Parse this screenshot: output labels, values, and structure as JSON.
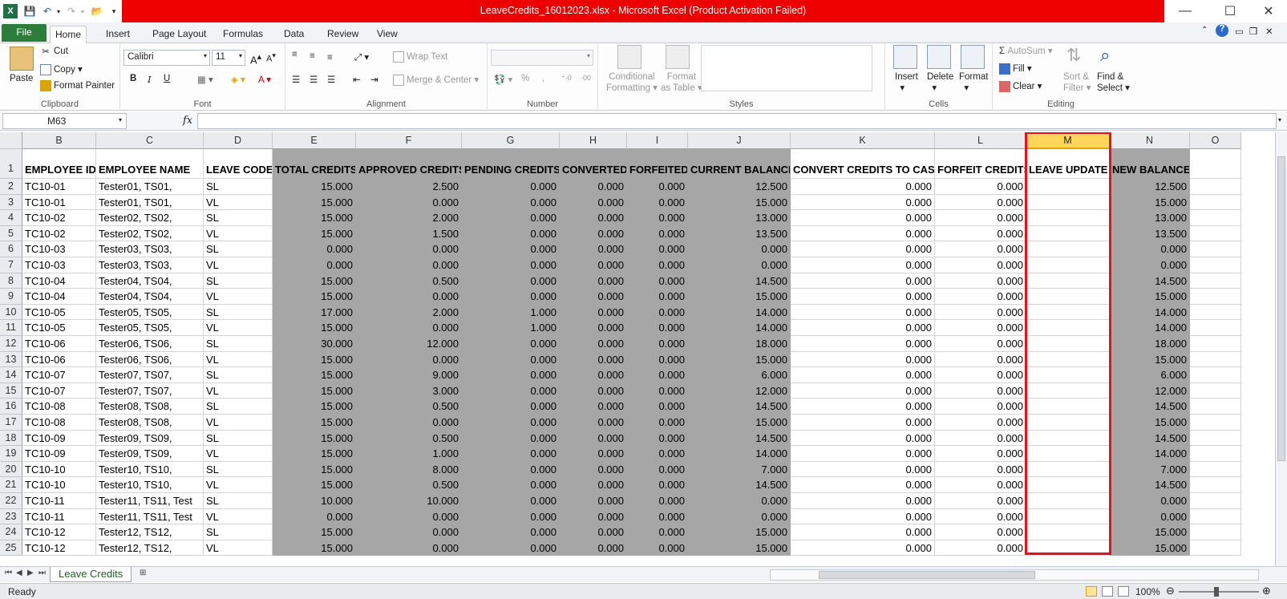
{
  "window": {
    "title": "LeaveCredits_16012023.xlsx  -  Microsoft Excel (Product Activation Failed)",
    "minimize": "—",
    "maximize": "☐",
    "close": "✕"
  },
  "tabs": [
    "File",
    "Home",
    "Insert",
    "Page Layout",
    "Formulas",
    "Data",
    "Review",
    "View"
  ],
  "ribbon": {
    "clipboard": {
      "paste": "Paste",
      "cut": "Cut",
      "copy": "Copy",
      "format_painter": "Format Painter",
      "label": "Clipboard"
    },
    "font": {
      "name": "Calibri",
      "size": "11",
      "bold": "B",
      "italic": "I",
      "underline": "U",
      "label": "Font"
    },
    "alignment": {
      "wrap_text": "Wrap Text",
      "merge_center": "Merge & Center",
      "label": "Alignment"
    },
    "number": {
      "percent": "%",
      "comma": ",",
      "label": "Number"
    },
    "styles": {
      "conditional": "Conditional",
      "formatting": "Formatting",
      "format": "Format",
      "as_table": "as Table",
      "label": "Styles"
    },
    "cells": {
      "insert": "Insert",
      "delete": "Delete",
      "format": "Format",
      "label": "Cells"
    },
    "editing": {
      "autosum": "AutoSum",
      "fill": "Fill",
      "clear": "Clear",
      "sort": "Sort &",
      "filter": "Filter",
      "find": "Find &",
      "select": "Select",
      "label": "Editing"
    }
  },
  "formula_bar": {
    "name_box": "M63",
    "fx": "fx",
    "value": ""
  },
  "columns": [
    "B",
    "C",
    "D",
    "E",
    "F",
    "G",
    "H",
    "I",
    "J",
    "K",
    "L",
    "M",
    "N",
    "O"
  ],
  "selected_column": "M",
  "header_row": [
    "EMPLOYEE ID",
    "EMPLOYEE NAME",
    "LEAVE CODE",
    "TOTAL CREDITS",
    "APPROVED CREDITS",
    "PENDING CREDITS",
    "CONVERTED",
    "FORFEITED",
    "CURRENT BALANCE",
    "CONVERT CREDITS TO CASH",
    "FORFEIT CREDITS",
    "LEAVE UPDATE",
    "NEW BALANCE",
    ""
  ],
  "rows": [
    [
      "TC10-01",
      "Tester01,  TS01,",
      "SL",
      "15.000",
      "2.500",
      "0.000",
      "0.000",
      "0.000",
      "12.500",
      "0.000",
      "0.000",
      "",
      "12.500",
      ""
    ],
    [
      "TC10-01",
      "Tester01,  TS01,",
      "VL",
      "15.000",
      "0.000",
      "0.000",
      "0.000",
      "0.000",
      "15.000",
      "0.000",
      "0.000",
      "",
      "15.000",
      ""
    ],
    [
      "TC10-02",
      "Tester02,  TS02,",
      "SL",
      "15.000",
      "2.000",
      "0.000",
      "0.000",
      "0.000",
      "13.000",
      "0.000",
      "0.000",
      "",
      "13.000",
      ""
    ],
    [
      "TC10-02",
      "Tester02,  TS02,",
      "VL",
      "15.000",
      "1.500",
      "0.000",
      "0.000",
      "0.000",
      "13.500",
      "0.000",
      "0.000",
      "",
      "13.500",
      ""
    ],
    [
      "TC10-03",
      "Tester03,  TS03,",
      "SL",
      "0.000",
      "0.000",
      "0.000",
      "0.000",
      "0.000",
      "0.000",
      "0.000",
      "0.000",
      "",
      "0.000",
      ""
    ],
    [
      "TC10-03",
      "Tester03,  TS03,",
      "VL",
      "0.000",
      "0.000",
      "0.000",
      "0.000",
      "0.000",
      "0.000",
      "0.000",
      "0.000",
      "",
      "0.000",
      ""
    ],
    [
      "TC10-04",
      "Tester04,  TS04,",
      "SL",
      "15.000",
      "0.500",
      "0.000",
      "0.000",
      "0.000",
      "14.500",
      "0.000",
      "0.000",
      "",
      "14.500",
      ""
    ],
    [
      "TC10-04",
      "Tester04,  TS04,",
      "VL",
      "15.000",
      "0.000",
      "0.000",
      "0.000",
      "0.000",
      "15.000",
      "0.000",
      "0.000",
      "",
      "15.000",
      ""
    ],
    [
      "TC10-05",
      "Tester05,  TS05,",
      "SL",
      "17.000",
      "2.000",
      "1.000",
      "0.000",
      "0.000",
      "14.000",
      "0.000",
      "0.000",
      "",
      "14.000",
      ""
    ],
    [
      "TC10-05",
      "Tester05,  TS05,",
      "VL",
      "15.000",
      "0.000",
      "1.000",
      "0.000",
      "0.000",
      "14.000",
      "0.000",
      "0.000",
      "",
      "14.000",
      ""
    ],
    [
      "TC10-06",
      "Tester06,  TS06,",
      "SL",
      "30.000",
      "12.000",
      "0.000",
      "0.000",
      "0.000",
      "18.000",
      "0.000",
      "0.000",
      "",
      "18.000",
      ""
    ],
    [
      "TC10-06",
      "Tester06,  TS06,",
      "VL",
      "15.000",
      "0.000",
      "0.000",
      "0.000",
      "0.000",
      "15.000",
      "0.000",
      "0.000",
      "",
      "15.000",
      ""
    ],
    [
      "TC10-07",
      "Tester07,  TS07,",
      "SL",
      "15.000",
      "9.000",
      "0.000",
      "0.000",
      "0.000",
      "6.000",
      "0.000",
      "0.000",
      "",
      "6.000",
      ""
    ],
    [
      "TC10-07",
      "Tester07,  TS07,",
      "VL",
      "15.000",
      "3.000",
      "0.000",
      "0.000",
      "0.000",
      "12.000",
      "0.000",
      "0.000",
      "",
      "12.000",
      ""
    ],
    [
      "TC10-08",
      "Tester08,  TS08,",
      "SL",
      "15.000",
      "0.500",
      "0.000",
      "0.000",
      "0.000",
      "14.500",
      "0.000",
      "0.000",
      "",
      "14.500",
      ""
    ],
    [
      "TC10-08",
      "Tester08,  TS08,",
      "VL",
      "15.000",
      "0.000",
      "0.000",
      "0.000",
      "0.000",
      "15.000",
      "0.000",
      "0.000",
      "",
      "15.000",
      ""
    ],
    [
      "TC10-09",
      "Tester09,  TS09,",
      "SL",
      "15.000",
      "0.500",
      "0.000",
      "0.000",
      "0.000",
      "14.500",
      "0.000",
      "0.000",
      "",
      "14.500",
      ""
    ],
    [
      "TC10-09",
      "Tester09,  TS09,",
      "VL",
      "15.000",
      "1.000",
      "0.000",
      "0.000",
      "0.000",
      "14.000",
      "0.000",
      "0.000",
      "",
      "14.000",
      ""
    ],
    [
      "TC10-10",
      "Tester10,  TS10,",
      "SL",
      "15.000",
      "8.000",
      "0.000",
      "0.000",
      "0.000",
      "7.000",
      "0.000",
      "0.000",
      "",
      "7.000",
      ""
    ],
    [
      "TC10-10",
      "Tester10,  TS10,",
      "VL",
      "15.000",
      "0.500",
      "0.000",
      "0.000",
      "0.000",
      "14.500",
      "0.000",
      "0.000",
      "",
      "14.500",
      ""
    ],
    [
      "TC10-11",
      "Tester11,  TS11, Test",
      "SL",
      "10.000",
      "10.000",
      "0.000",
      "0.000",
      "0.000",
      "0.000",
      "0.000",
      "0.000",
      "",
      "0.000",
      ""
    ],
    [
      "TC10-11",
      "Tester11,  TS11, Test",
      "VL",
      "0.000",
      "0.000",
      "0.000",
      "0.000",
      "0.000",
      "0.000",
      "0.000",
      "0.000",
      "",
      "0.000",
      ""
    ],
    [
      "TC10-12",
      "Tester12,  TS12,",
      "SL",
      "15.000",
      "0.000",
      "0.000",
      "0.000",
      "0.000",
      "15.000",
      "0.000",
      "0.000",
      "",
      "15.000",
      ""
    ],
    [
      "TC10-12",
      "Tester12,  TS12,",
      "VL",
      "15.000",
      "0.000",
      "0.000",
      "0.000",
      "0.000",
      "15.000",
      "0.000",
      "0.000",
      "",
      "15.000",
      ""
    ]
  ],
  "sheet_tabs": [
    "Leave Credits"
  ],
  "status": {
    "ready": "Ready",
    "zoom": "100%"
  },
  "colors": {
    "title_bar": "#ee0000",
    "file_tab": "#2c7c3a",
    "gray_fill": "#a6a6a6",
    "highlight_box": "#e8101c",
    "selected_header": "#ffd55a"
  }
}
